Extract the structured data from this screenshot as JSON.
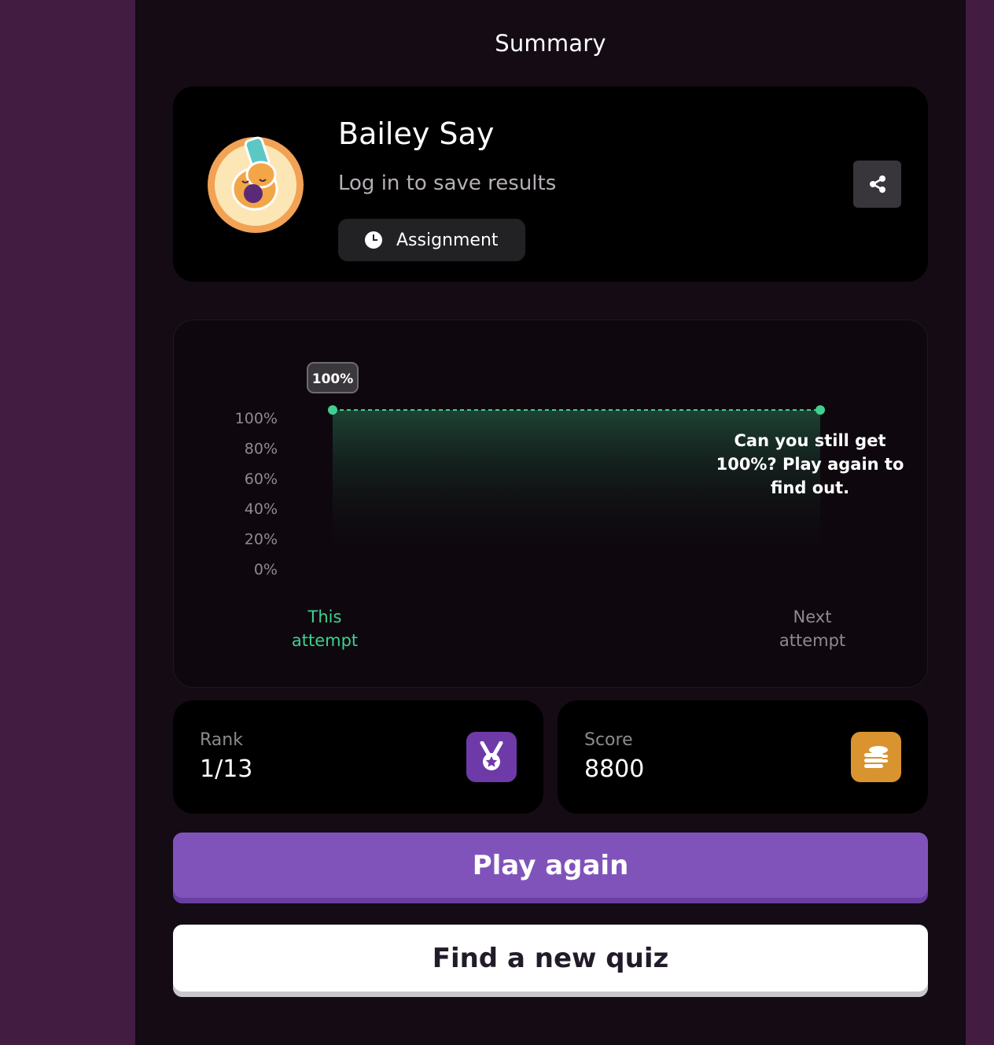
{
  "page": {
    "title": "Summary"
  },
  "profile": {
    "name": "Bailey Say",
    "login_prompt": "Log in to save results",
    "mode_label": "Assignment",
    "avatar_icon": "guitar-avatar-icon",
    "share_icon": "share-icon"
  },
  "chart_data": {
    "type": "line",
    "categories": [
      "This attempt",
      "Next attempt"
    ],
    "series": [
      {
        "values": [
          100,
          100
        ]
      }
    ],
    "y_ticks": [
      "100%",
      "80%",
      "60%",
      "40%",
      "20%",
      "0%"
    ],
    "ylim": [
      0,
      100
    ],
    "point_label": "100%",
    "annotation": "Can you still get 100%? Play again to find out.",
    "colors": {
      "line": "#3fd08f",
      "active_label": "#3fd08f",
      "inactive_label": "#8e8a8e"
    }
  },
  "stats": {
    "rank": {
      "label": "Rank",
      "value": "1/13",
      "icon": "medal-icon",
      "color": "#6e3aa8"
    },
    "score": {
      "label": "Score",
      "value": "8800",
      "icon": "coins-icon",
      "color": "#d9932f"
    }
  },
  "actions": {
    "play_again": "Play again",
    "find_quiz": "Find a new quiz"
  }
}
